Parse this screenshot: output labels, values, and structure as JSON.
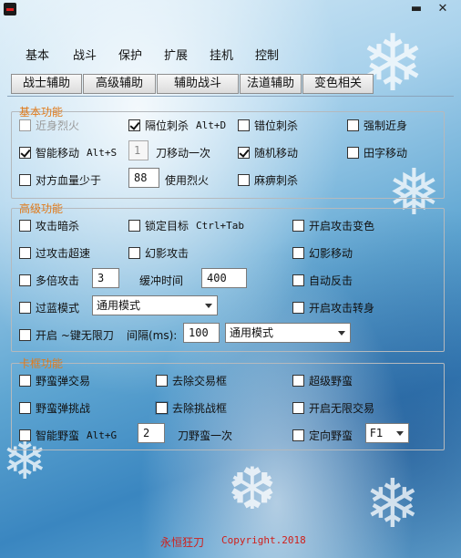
{
  "titlebar": {
    "minimize_glyph": "▬",
    "close_glyph": "✕"
  },
  "main_tabs": [
    "基本",
    "战斗",
    "保护",
    "扩展",
    "挂机",
    "控制"
  ],
  "sub_tabs": [
    "战士辅助",
    "高级辅助",
    "辅助战斗",
    "法道辅助",
    "变色相关"
  ],
  "basic": {
    "title": "基本功能",
    "near_fire": "近身烈火",
    "gap_slash": "隔位刺杀",
    "gap_slash_hotkey": "Alt+D",
    "offset_slash": "错位刺杀",
    "force_near": "强制近身",
    "smart_move": "智能移动",
    "smart_move_hotkey": "Alt+S",
    "blade_count": "1",
    "blade_move_label": "刀移动一次",
    "random_move": "随机移动",
    "field_move": "田字移动",
    "enemy_hp_below": "对方血量少于",
    "hp_value": "88",
    "use_fire_label": "使用烈火",
    "paralysis_slash": "麻痹刺杀"
  },
  "advanced": {
    "title": "高级功能",
    "attack_stealth": "攻击暗杀",
    "lock_target": "锁定目标",
    "lock_target_hotkey": "Ctrl+Tab",
    "attack_color": "开启攻击变色",
    "attack_overspeed": "过攻击超速",
    "phantom_attack": "幻影攻击",
    "phantom_move": "幻影移动",
    "multi_attack": "多倍攻击",
    "multi_value": "3",
    "buffer_label": "缓冲时间",
    "buffer_value": "400",
    "auto_counter": "自动反击",
    "blue_mode": "过蓝模式",
    "blue_mode_value": "通用模式",
    "attack_turn": "开启攻击转身",
    "unlimited_key": "开启 ~键无限刀",
    "interval_label": "间隔(ms):",
    "interval_value": "100",
    "unlimited_mode_value": "通用模式"
  },
  "barbarian": {
    "title": "卡框功能",
    "bounce_trade": "野蛮弹交易",
    "remove_trade_box": "去除交易框",
    "super_barbarian": "超级野蛮",
    "bounce_challenge": "野蛮弹挑战",
    "remove_challenge_box": "去除挑战框",
    "unlimited_trade": "开启无限交易",
    "smart_barbarian": "智能野蛮",
    "smart_barbarian_hotkey": "Alt+G",
    "blade_value": "2",
    "blade_barbarian_label": "刀野蛮一次",
    "directed_barbarian": "定向野蛮",
    "directed_key_value": "F1"
  },
  "footer": {
    "name": "永恒狂刀",
    "copyright": "Copyright.2018"
  },
  "colors": {
    "group_title": "#e07a1a",
    "footer": "#d0201b"
  }
}
